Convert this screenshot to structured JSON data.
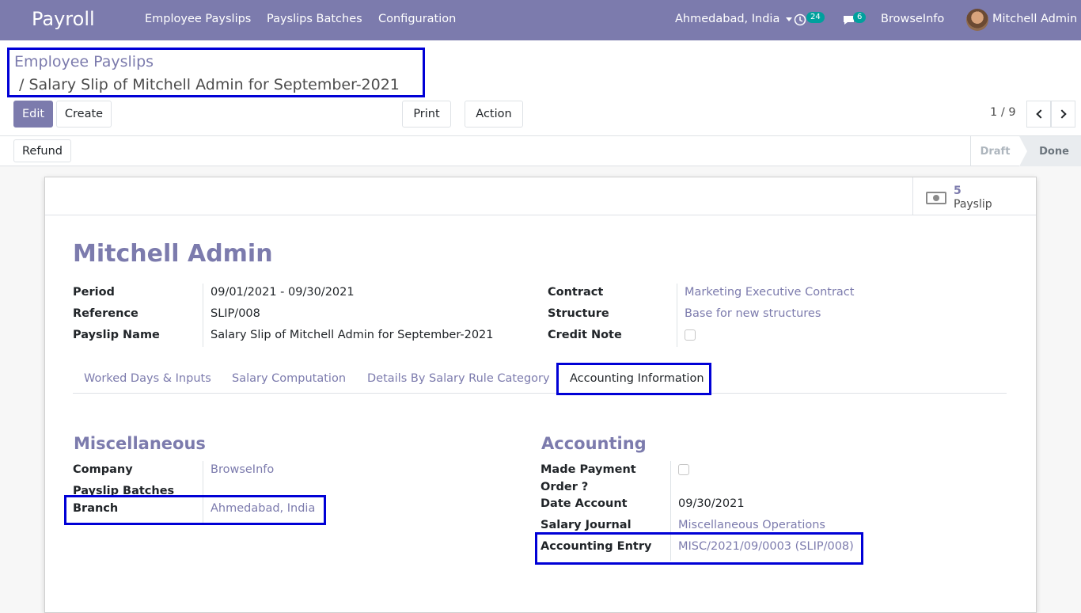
{
  "navbar": {
    "app_name": "Payroll",
    "menu": [
      "Employee Payslips",
      "Payslips Batches",
      "Configuration"
    ],
    "branch_selector": "Ahmedabad, India",
    "activity_count": "24",
    "messages_count": "6",
    "company": "BrowseInfo",
    "user": "Mitchell Admin"
  },
  "breadcrumb": {
    "parent": "Employee Payslips",
    "current": "/ Salary Slip of Mitchell Admin for September-2021"
  },
  "buttons": {
    "edit": "Edit",
    "create": "Create",
    "print": "Print",
    "action": "Action",
    "refund": "Refund"
  },
  "pager": {
    "value": "1 / 9"
  },
  "status": {
    "draft": "Draft",
    "done": "Done"
  },
  "stat_button": {
    "value": "5",
    "label": "Payslip"
  },
  "employee_name": "Mitchell Admin",
  "fields_left": {
    "period_label": "Period",
    "period_value": "09/01/2021 - 09/30/2021",
    "reference_label": "Reference",
    "reference_value": "SLIP/008",
    "name_label": "Payslip Name",
    "name_value": "Salary Slip of Mitchell Admin for September-2021"
  },
  "fields_right": {
    "contract_label": "Contract",
    "contract_value": "Marketing Executive Contract",
    "structure_label": "Structure",
    "structure_value": "Base for new structures",
    "credit_note_label": "Credit Note"
  },
  "tabs": [
    "Worked Days & Inputs",
    "Salary Computation",
    "Details By Salary Rule Category",
    "Accounting Information"
  ],
  "misc": {
    "title": "Miscellaneous",
    "company_label": "Company",
    "company_value": "BrowseInfo",
    "batches_label": "Payslip Batches",
    "branch_label": "Branch",
    "branch_value": "Ahmedabad, India"
  },
  "accounting": {
    "title": "Accounting",
    "made_payment_label_1": "Made Payment",
    "made_payment_label_2": "Order ?",
    "date_account_label": "Date Account",
    "date_account_value": "09/30/2021",
    "journal_label": "Salary Journal",
    "journal_value": "Miscellaneous Operations",
    "entry_label": "Accounting Entry",
    "entry_value": "MISC/2021/09/0003 (SLIP/008)"
  },
  "colors": {
    "brand": "#7c7bad",
    "highlight": "#0000d6",
    "badge": "#00a09d"
  }
}
